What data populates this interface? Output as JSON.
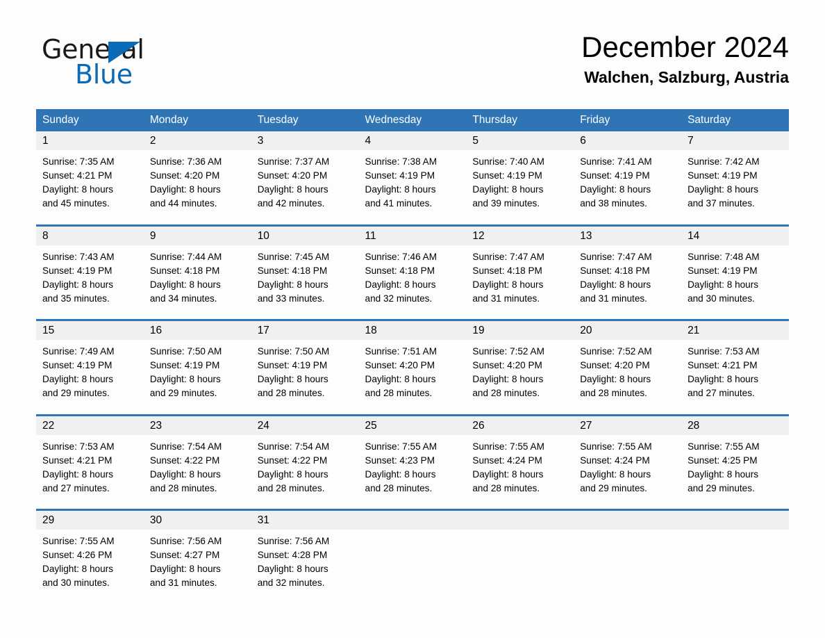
{
  "brand": {
    "name_part1": "General",
    "name_part2": "Blue",
    "triangle_icon": "blue-triangle-icon",
    "accent_color": "#0a6ab5"
  },
  "header": {
    "title": "December 2024",
    "location": "Walchen, Salzburg, Austria"
  },
  "theme": {
    "header_blue": "#2f75b5",
    "date_band_gray": "#f0f0f0",
    "page_background": "#fdfdfd"
  },
  "weekdays": [
    "Sunday",
    "Monday",
    "Tuesday",
    "Wednesday",
    "Thursday",
    "Friday",
    "Saturday"
  ],
  "weeks": [
    [
      {
        "date": "1",
        "sunrise": "Sunrise: 7:35 AM",
        "sunset": "Sunset: 4:21 PM",
        "daylight_line1": "Daylight: 8 hours",
        "daylight_line2": "and 45 minutes."
      },
      {
        "date": "2",
        "sunrise": "Sunrise: 7:36 AM",
        "sunset": "Sunset: 4:20 PM",
        "daylight_line1": "Daylight: 8 hours",
        "daylight_line2": "and 44 minutes."
      },
      {
        "date": "3",
        "sunrise": "Sunrise: 7:37 AM",
        "sunset": "Sunset: 4:20 PM",
        "daylight_line1": "Daylight: 8 hours",
        "daylight_line2": "and 42 minutes."
      },
      {
        "date": "4",
        "sunrise": "Sunrise: 7:38 AM",
        "sunset": "Sunset: 4:19 PM",
        "daylight_line1": "Daylight: 8 hours",
        "daylight_line2": "and 41 minutes."
      },
      {
        "date": "5",
        "sunrise": "Sunrise: 7:40 AM",
        "sunset": "Sunset: 4:19 PM",
        "daylight_line1": "Daylight: 8 hours",
        "daylight_line2": "and 39 minutes."
      },
      {
        "date": "6",
        "sunrise": "Sunrise: 7:41 AM",
        "sunset": "Sunset: 4:19 PM",
        "daylight_line1": "Daylight: 8 hours",
        "daylight_line2": "and 38 minutes."
      },
      {
        "date": "7",
        "sunrise": "Sunrise: 7:42 AM",
        "sunset": "Sunset: 4:19 PM",
        "daylight_line1": "Daylight: 8 hours",
        "daylight_line2": "and 37 minutes."
      }
    ],
    [
      {
        "date": "8",
        "sunrise": "Sunrise: 7:43 AM",
        "sunset": "Sunset: 4:19 PM",
        "daylight_line1": "Daylight: 8 hours",
        "daylight_line2": "and 35 minutes."
      },
      {
        "date": "9",
        "sunrise": "Sunrise: 7:44 AM",
        "sunset": "Sunset: 4:18 PM",
        "daylight_line1": "Daylight: 8 hours",
        "daylight_line2": "and 34 minutes."
      },
      {
        "date": "10",
        "sunrise": "Sunrise: 7:45 AM",
        "sunset": "Sunset: 4:18 PM",
        "daylight_line1": "Daylight: 8 hours",
        "daylight_line2": "and 33 minutes."
      },
      {
        "date": "11",
        "sunrise": "Sunrise: 7:46 AM",
        "sunset": "Sunset: 4:18 PM",
        "daylight_line1": "Daylight: 8 hours",
        "daylight_line2": "and 32 minutes."
      },
      {
        "date": "12",
        "sunrise": "Sunrise: 7:47 AM",
        "sunset": "Sunset: 4:18 PM",
        "daylight_line1": "Daylight: 8 hours",
        "daylight_line2": "and 31 minutes."
      },
      {
        "date": "13",
        "sunrise": "Sunrise: 7:47 AM",
        "sunset": "Sunset: 4:18 PM",
        "daylight_line1": "Daylight: 8 hours",
        "daylight_line2": "and 31 minutes."
      },
      {
        "date": "14",
        "sunrise": "Sunrise: 7:48 AM",
        "sunset": "Sunset: 4:19 PM",
        "daylight_line1": "Daylight: 8 hours",
        "daylight_line2": "and 30 minutes."
      }
    ],
    [
      {
        "date": "15",
        "sunrise": "Sunrise: 7:49 AM",
        "sunset": "Sunset: 4:19 PM",
        "daylight_line1": "Daylight: 8 hours",
        "daylight_line2": "and 29 minutes."
      },
      {
        "date": "16",
        "sunrise": "Sunrise: 7:50 AM",
        "sunset": "Sunset: 4:19 PM",
        "daylight_line1": "Daylight: 8 hours",
        "daylight_line2": "and 29 minutes."
      },
      {
        "date": "17",
        "sunrise": "Sunrise: 7:50 AM",
        "sunset": "Sunset: 4:19 PM",
        "daylight_line1": "Daylight: 8 hours",
        "daylight_line2": "and 28 minutes."
      },
      {
        "date": "18",
        "sunrise": "Sunrise: 7:51 AM",
        "sunset": "Sunset: 4:20 PM",
        "daylight_line1": "Daylight: 8 hours",
        "daylight_line2": "and 28 minutes."
      },
      {
        "date": "19",
        "sunrise": "Sunrise: 7:52 AM",
        "sunset": "Sunset: 4:20 PM",
        "daylight_line1": "Daylight: 8 hours",
        "daylight_line2": "and 28 minutes."
      },
      {
        "date": "20",
        "sunrise": "Sunrise: 7:52 AM",
        "sunset": "Sunset: 4:20 PM",
        "daylight_line1": "Daylight: 8 hours",
        "daylight_line2": "and 28 minutes."
      },
      {
        "date": "21",
        "sunrise": "Sunrise: 7:53 AM",
        "sunset": "Sunset: 4:21 PM",
        "daylight_line1": "Daylight: 8 hours",
        "daylight_line2": "and 27 minutes."
      }
    ],
    [
      {
        "date": "22",
        "sunrise": "Sunrise: 7:53 AM",
        "sunset": "Sunset: 4:21 PM",
        "daylight_line1": "Daylight: 8 hours",
        "daylight_line2": "and 27 minutes."
      },
      {
        "date": "23",
        "sunrise": "Sunrise: 7:54 AM",
        "sunset": "Sunset: 4:22 PM",
        "daylight_line1": "Daylight: 8 hours",
        "daylight_line2": "and 28 minutes."
      },
      {
        "date": "24",
        "sunrise": "Sunrise: 7:54 AM",
        "sunset": "Sunset: 4:22 PM",
        "daylight_line1": "Daylight: 8 hours",
        "daylight_line2": "and 28 minutes."
      },
      {
        "date": "25",
        "sunrise": "Sunrise: 7:55 AM",
        "sunset": "Sunset: 4:23 PM",
        "daylight_line1": "Daylight: 8 hours",
        "daylight_line2": "and 28 minutes."
      },
      {
        "date": "26",
        "sunrise": "Sunrise: 7:55 AM",
        "sunset": "Sunset: 4:24 PM",
        "daylight_line1": "Daylight: 8 hours",
        "daylight_line2": "and 28 minutes."
      },
      {
        "date": "27",
        "sunrise": "Sunrise: 7:55 AM",
        "sunset": "Sunset: 4:24 PM",
        "daylight_line1": "Daylight: 8 hours",
        "daylight_line2": "and 29 minutes."
      },
      {
        "date": "28",
        "sunrise": "Sunrise: 7:55 AM",
        "sunset": "Sunset: 4:25 PM",
        "daylight_line1": "Daylight: 8 hours",
        "daylight_line2": "and 29 minutes."
      }
    ],
    [
      {
        "date": "29",
        "sunrise": "Sunrise: 7:55 AM",
        "sunset": "Sunset: 4:26 PM",
        "daylight_line1": "Daylight: 8 hours",
        "daylight_line2": "and 30 minutes."
      },
      {
        "date": "30",
        "sunrise": "Sunrise: 7:56 AM",
        "sunset": "Sunset: 4:27 PM",
        "daylight_line1": "Daylight: 8 hours",
        "daylight_line2": "and 31 minutes."
      },
      {
        "date": "31",
        "sunrise": "Sunrise: 7:56 AM",
        "sunset": "Sunset: 4:28 PM",
        "daylight_line1": "Daylight: 8 hours",
        "daylight_line2": "and 32 minutes."
      },
      {
        "date": "",
        "sunrise": "",
        "sunset": "",
        "daylight_line1": "",
        "daylight_line2": ""
      },
      {
        "date": "",
        "sunrise": "",
        "sunset": "",
        "daylight_line1": "",
        "daylight_line2": ""
      },
      {
        "date": "",
        "sunrise": "",
        "sunset": "",
        "daylight_line1": "",
        "daylight_line2": ""
      },
      {
        "date": "",
        "sunrise": "",
        "sunset": "",
        "daylight_line1": "",
        "daylight_line2": ""
      }
    ]
  ]
}
